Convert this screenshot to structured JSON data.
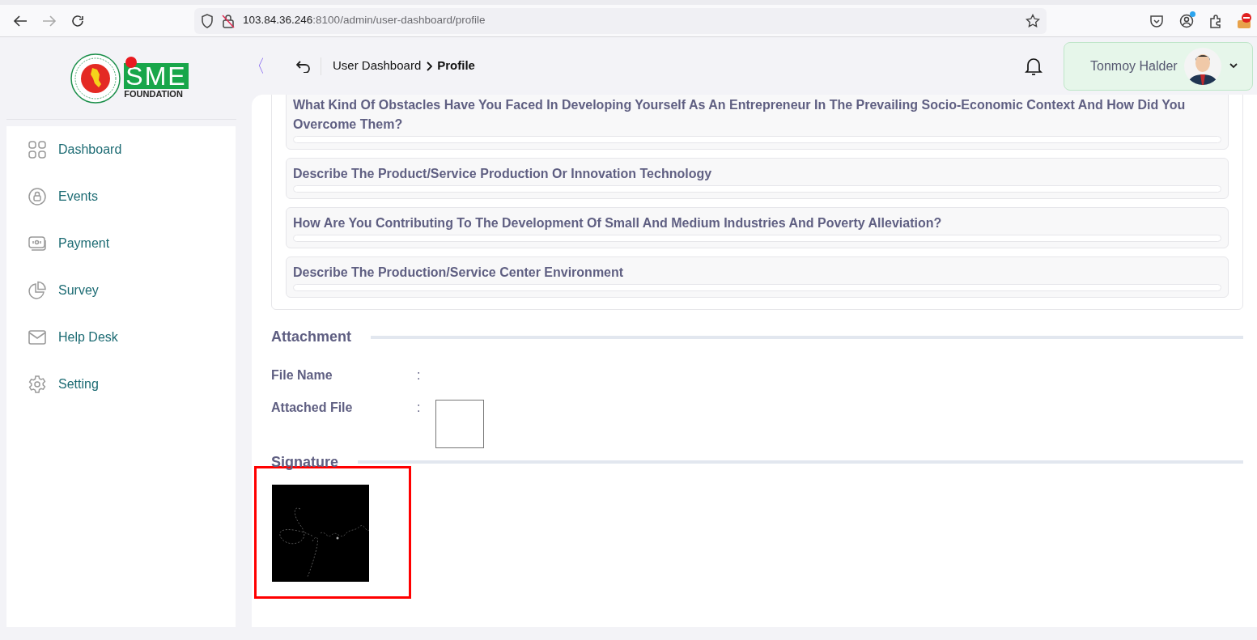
{
  "browser": {
    "url_host": "103.84.36.246",
    "url_path": ":8100/admin/user-dashboard/profile"
  },
  "logo": {
    "brand": "SME",
    "subtitle": "FOUNDATION"
  },
  "sidebar": {
    "items": [
      {
        "label": "Dashboard"
      },
      {
        "label": "Events"
      },
      {
        "label": "Payment"
      },
      {
        "label": "Survey"
      },
      {
        "label": "Help Desk"
      },
      {
        "label": "Setting"
      }
    ]
  },
  "header": {
    "collapse": "〈",
    "breadcrumb": [
      "User Dashboard",
      "Profile"
    ],
    "user_name": "Tonmoy Halder"
  },
  "questions": [
    {
      "text": "What Kind Of Obstacles Have You Faced In Developing Yourself As An Entrepreneur In The Prevailing Socio-Economic Context And How Did You Overcome Them?"
    },
    {
      "text": "Describe The Product/Service Production Or Innovation Technology"
    },
    {
      "text": "How Are You Contributing To The Development Of Small And Medium Industries And Poverty Alleviation?"
    },
    {
      "text": "Describe The Production/Service Center Environment"
    }
  ],
  "attachment": {
    "title": "Attachment",
    "fields": [
      {
        "label": "File Name",
        "separator": ":",
        "kind": "text"
      },
      {
        "label": "Attached File",
        "separator": ":",
        "kind": "file"
      }
    ]
  },
  "signature": {
    "title": "Signature",
    "highlighted": true
  }
}
